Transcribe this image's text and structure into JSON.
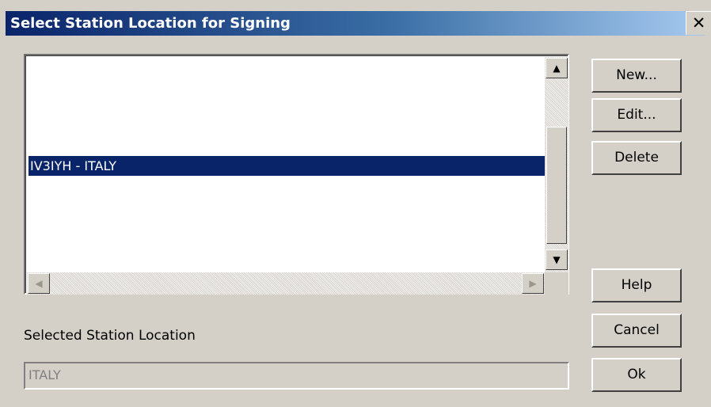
{
  "window": {
    "title": "Select Station Location for Signing",
    "close_glyph": "✕"
  },
  "list": {
    "items": [
      "IV3IYH - ITALY"
    ],
    "selected_index": 0
  },
  "scrollbar": {
    "up": "▲",
    "down": "▼",
    "left": "◀",
    "right": "▶"
  },
  "buttons": {
    "new": "New...",
    "edit": "Edit...",
    "delete": "Delete",
    "help": "Help",
    "cancel": "Cancel",
    "ok": "Ok"
  },
  "selected_location": {
    "label": "Selected Station Location",
    "value": "ITALY"
  },
  "colors": {
    "selection": "#0a246a",
    "dialog_face": "#d4d0c8"
  }
}
